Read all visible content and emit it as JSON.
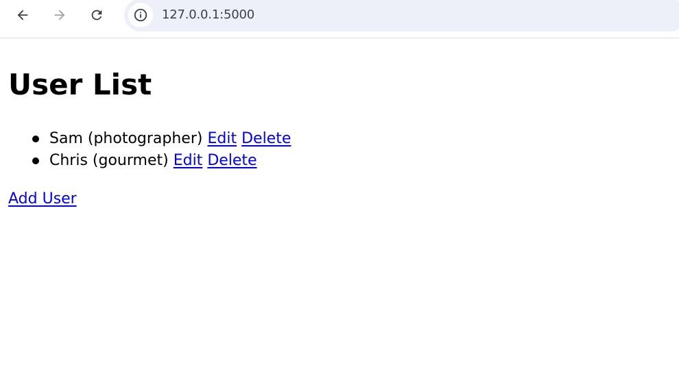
{
  "browser": {
    "url": "127.0.0.1:5000",
    "back_icon": "arrow-left",
    "forward_icon": "arrow-right",
    "reload_icon": "reload",
    "site_info_icon": "info-circle"
  },
  "page": {
    "heading": "User List",
    "users": [
      {
        "text": "Sam (photographer)",
        "edit": "Edit",
        "delete": "Delete"
      },
      {
        "text": "Chris (gourmet)",
        "edit": "Edit",
        "delete": "Delete"
      }
    ],
    "add_user": "Add User"
  },
  "colors": {
    "link": "#0000ee",
    "omnibox_bg": "#edf0f8",
    "text": "#000000"
  }
}
